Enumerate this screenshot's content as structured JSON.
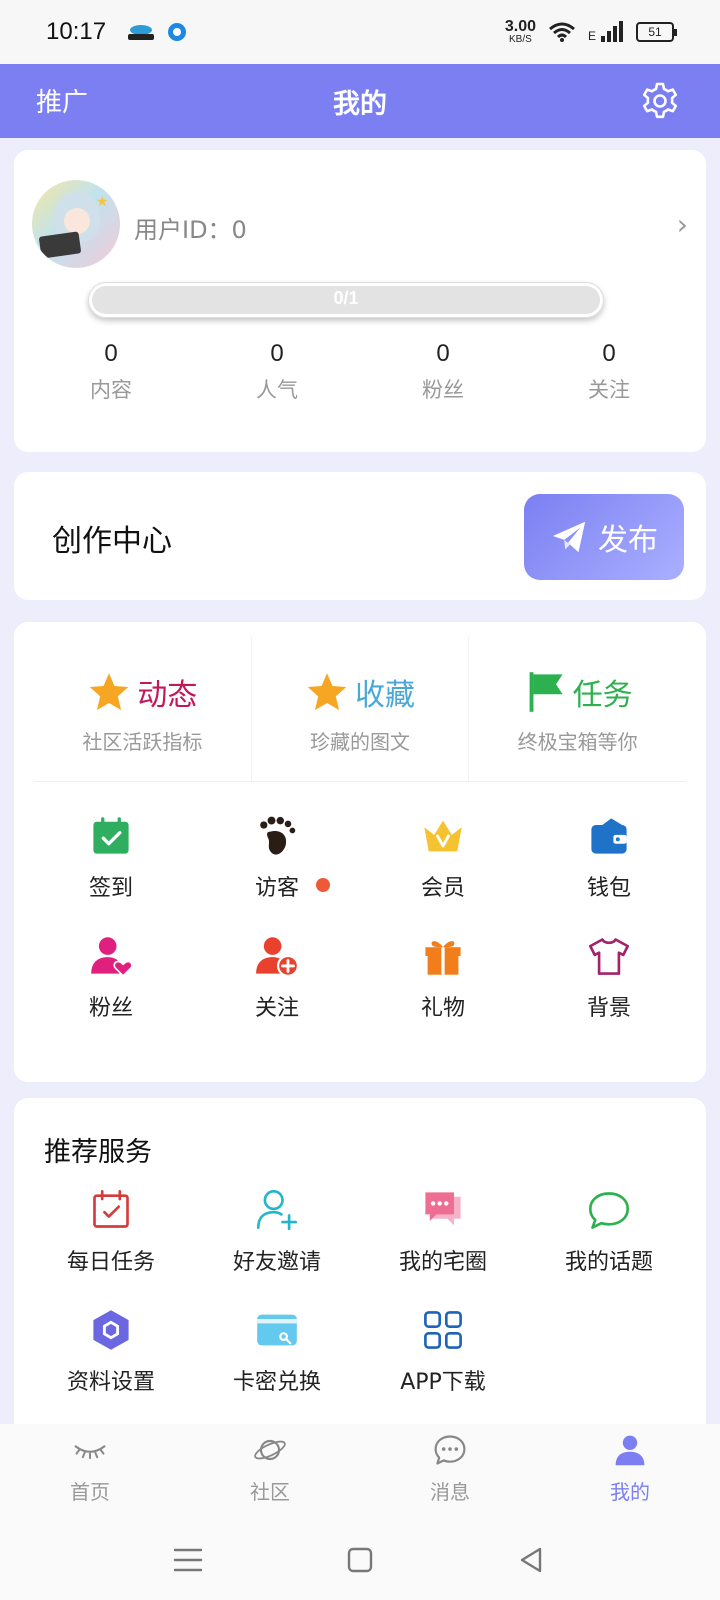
{
  "status_bar": {
    "time": "10:17",
    "net_speed": "3.00",
    "net_unit": "KB/S",
    "network_label": "E",
    "battery": "51"
  },
  "header": {
    "left_label": "推广",
    "title": "我的",
    "settings_icon": "gear-icon"
  },
  "profile": {
    "user_id_text": "用户ID：0",
    "progress_text": "0/1",
    "progress_value": 0,
    "stats": [
      {
        "value": "0",
        "label": "内容"
      },
      {
        "value": "0",
        "label": "人气"
      },
      {
        "value": "0",
        "label": "粉丝"
      },
      {
        "value": "0",
        "label": "关注"
      }
    ]
  },
  "creation": {
    "title": "创作中心",
    "publish_label": "发布"
  },
  "features": [
    {
      "title": "动态",
      "subtitle": "社区活跃指标",
      "icon": "star-icon",
      "color": "#c2185b"
    },
    {
      "title": "收藏",
      "subtitle": "珍藏的图文",
      "icon": "star-icon",
      "color": "#4aa8d8"
    },
    {
      "title": "任务",
      "subtitle": "终极宝箱等你",
      "icon": "flag-icon",
      "color": "#2db14e"
    }
  ],
  "quick_grid": [
    {
      "label": "签到",
      "icon": "calendar-check-icon"
    },
    {
      "label": "访客",
      "icon": "footprint-icon"
    },
    {
      "label": "会员",
      "icon": "crown-icon"
    },
    {
      "label": "钱包",
      "icon": "wallet-icon"
    },
    {
      "label": "粉丝",
      "icon": "user-heart-icon"
    },
    {
      "label": "关注",
      "icon": "user-add-icon"
    },
    {
      "label": "礼物",
      "icon": "gift-icon"
    },
    {
      "label": "背景",
      "icon": "tshirt-icon"
    }
  ],
  "services": {
    "title": "推荐服务",
    "items": [
      {
        "label": "每日任务",
        "icon": "calendar-task-icon"
      },
      {
        "label": "好友邀请",
        "icon": "user-invite-icon"
      },
      {
        "label": "我的宅圈",
        "icon": "chat-bubbles-icon"
      },
      {
        "label": "我的话题",
        "icon": "chat-bubble-icon"
      },
      {
        "label": "资料设置",
        "icon": "hexagon-icon"
      },
      {
        "label": "卡密兑换",
        "icon": "card-icon"
      },
      {
        "label": "APP下载",
        "icon": "grid-apps-icon"
      }
    ]
  },
  "bottom_nav": [
    {
      "label": "首页",
      "icon": "eye-closed-icon"
    },
    {
      "label": "社区",
      "icon": "planet-icon"
    },
    {
      "label": "消息",
      "icon": "message-icon"
    },
    {
      "label": "我的",
      "icon": "person-icon",
      "active": true
    }
  ],
  "colors": {
    "accent": "#7b7ff2",
    "background": "#ededfb"
  }
}
